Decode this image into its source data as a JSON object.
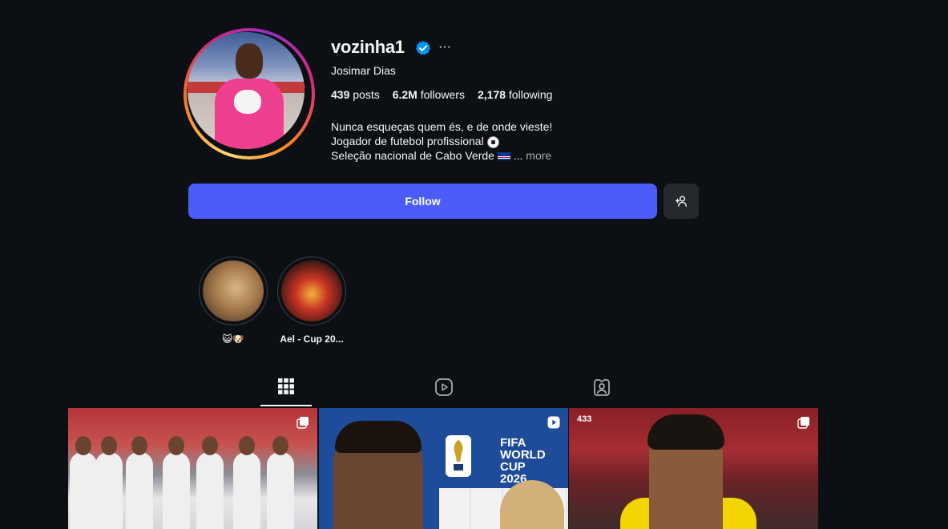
{
  "profile": {
    "username": "vozinha1",
    "verified": true,
    "full_name": "Josimar Dias",
    "stats": {
      "posts_count": "439",
      "posts_label": "posts",
      "followers_count": "6.2M",
      "followers_label": "followers",
      "following_count": "2,178",
      "following_label": "following"
    },
    "bio": {
      "line1": "Nunca esqueças quem és, e de onde vieste!",
      "line2": "Jogador de futebol profissional",
      "line3": "Seleção nacional de Cabo Verde",
      "ellipsis": " ...",
      "more_label": "more"
    },
    "more_options_icon": "···"
  },
  "actions": {
    "follow_label": "Follow",
    "suggest_icon": "person-add-icon"
  },
  "highlights": [
    {
      "label": "😺🐶"
    },
    {
      "label": "Ael - Cup 20..."
    }
  ],
  "tabs": [
    {
      "name": "posts",
      "icon": "grid-icon",
      "active": true
    },
    {
      "name": "reels",
      "icon": "reels-icon",
      "active": false
    },
    {
      "name": "tagged",
      "icon": "tagged-icon",
      "active": false
    }
  ],
  "grid": [
    {
      "type": "carousel",
      "badge_icon": "carousel-icon"
    },
    {
      "type": "reel",
      "badge_icon": "reel-play-icon",
      "overlay_text": [
        "FIFA",
        "WORLD CUP",
        "2026"
      ]
    },
    {
      "type": "carousel",
      "badge_icon": "carousel-icon",
      "corner_logo": "433"
    }
  ],
  "colors": {
    "background": "#0c1014",
    "follow_button": "#4a5df9",
    "secondary_button": "#25292e",
    "verified_badge": "#0095f6",
    "muted_text": "#a8a8a8"
  }
}
